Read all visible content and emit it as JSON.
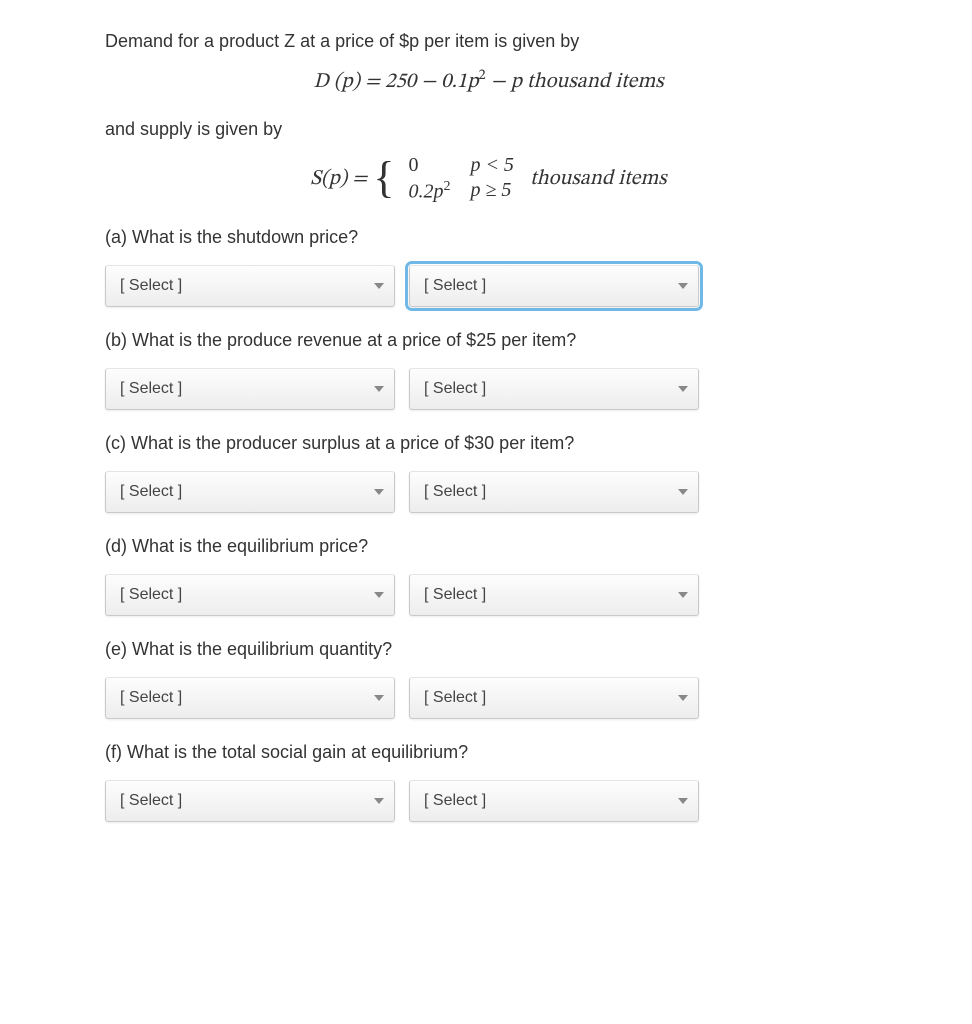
{
  "intro_line1": "Demand for a product Z at a price of $p per item is given by",
  "demand_eq_left": "D (p) = 250 − 0.1p",
  "demand_eq_tail": " − p thousand items",
  "intro_line2": "and supply is given by",
  "supply_lhs": "S(p) = ",
  "supply_case1_val": "0",
  "supply_case1_cond": "p < 5",
  "supply_case2_val": "0.2p",
  "supply_case2_cond": "p ≥ 5",
  "supply_units": " thousand items",
  "select_placeholder": "[ Select ]",
  "questions": {
    "a": "(a) What is the shutdown price?",
    "b": "(b) What is the produce revenue at a price of $25 per item?",
    "c": "(c) What is the producer surplus at a price of $30 per item?",
    "d": "(d) What is the equilibrium price?",
    "e": "(e) What is the equilibrium quantity?",
    "f": "(f) What is the total social gain at equilibrium?"
  }
}
